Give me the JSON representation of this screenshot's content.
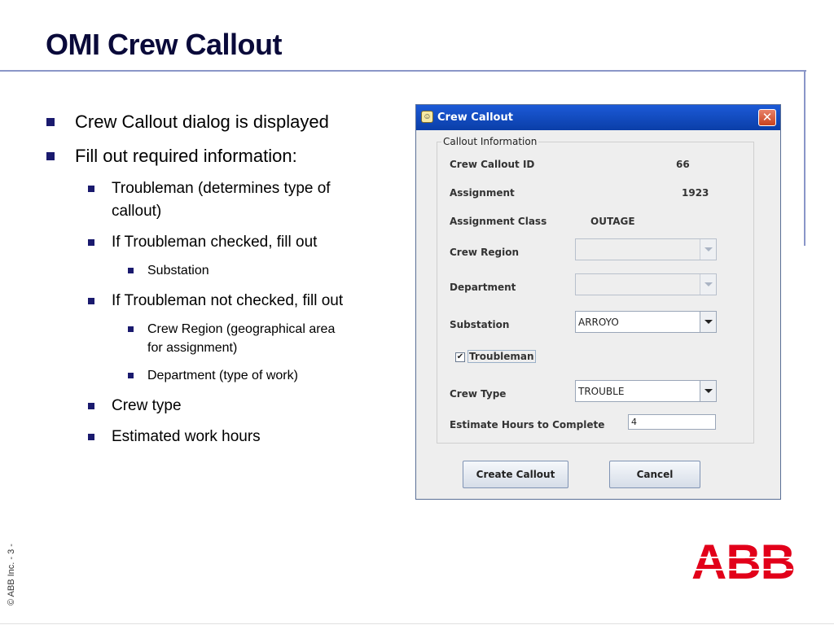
{
  "slide": {
    "title": "OMI Crew Callout",
    "footer": "© ABB Inc. - 3 -",
    "logo_text": "ABB",
    "accent_color": "#8a96c8",
    "logo_color": "#e2001a"
  },
  "bullets": [
    {
      "level": 1,
      "text": "Crew Callout dialog is displayed"
    },
    {
      "level": 1,
      "text": "Fill out required information:"
    },
    {
      "level": 2,
      "text": "Troubleman (determines type of"
    },
    {
      "level": 2,
      "text": "callout)"
    },
    {
      "level": 2,
      "text": "If Troubleman checked, fill out"
    },
    {
      "level": 3,
      "text": "Substation"
    },
    {
      "level": 2,
      "text": "If Troubleman not checked, fill out"
    },
    {
      "level": 3,
      "text": "Crew Region (geographical area"
    },
    {
      "level": 3,
      "text": "for assignment)"
    },
    {
      "level": 3,
      "text": "Department (type of work)"
    },
    {
      "level": 2,
      "text": "Crew type"
    },
    {
      "level": 2,
      "text": "Estimated work hours"
    }
  ],
  "dialog": {
    "title": "Crew Callout",
    "close_glyph": "✕",
    "group_title": "Callout Information",
    "fields": {
      "crew_callout_id": {
        "label": "Crew Callout ID",
        "value": "66"
      },
      "assignment": {
        "label": "Assignment",
        "value": "1923"
      },
      "assignment_class": {
        "label": "Assignment Class",
        "value": "OUTAGE"
      },
      "crew_region": {
        "label": "Crew Region",
        "value": ""
      },
      "department": {
        "label": "Department",
        "value": ""
      },
      "substation": {
        "label": "Substation",
        "value": "ARROYO"
      },
      "troubleman": {
        "label": "Troubleman",
        "checked": true
      },
      "crew_type": {
        "label": "Crew Type",
        "value": "TROUBLE"
      },
      "estimate_hours": {
        "label": "Estimate Hours to Complete",
        "value": "4"
      }
    },
    "buttons": {
      "create": "Create Callout",
      "cancel": "Cancel"
    }
  }
}
